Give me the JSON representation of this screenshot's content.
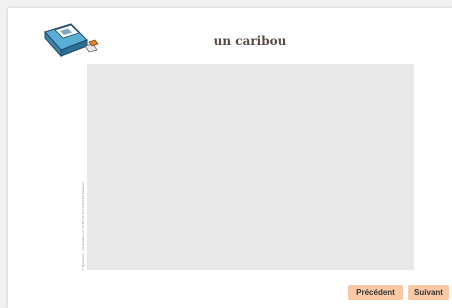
{
  "page": {
    "title": "un caribou",
    "image_credit": "© Bjørnstrom – Ice Reviews Ltd. CC-BY-NC-SA 2.0 Bertrand Beaumont"
  },
  "nav": {
    "prev_label": "Précédent",
    "next_label": "Suivant"
  },
  "icons": {
    "logo": "printer-logo-icon"
  },
  "colors": {
    "button_bg": "#f9c9a6",
    "image_placeholder": "#e8e8e8",
    "title": "#5a4a42"
  }
}
